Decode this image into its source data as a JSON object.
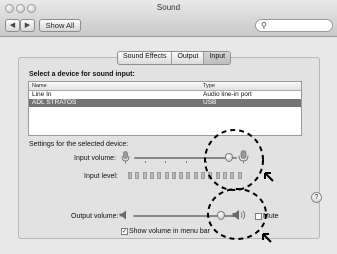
{
  "window": {
    "title": "Sound"
  },
  "toolbar": {
    "back": "◀",
    "forward": "▶",
    "show_all": "Show All",
    "search_placeholder": ""
  },
  "tabs": [
    {
      "label": "Sound Effects",
      "selected": false
    },
    {
      "label": "Output",
      "selected": false
    },
    {
      "label": "Input",
      "selected": true
    }
  ],
  "panel": {
    "heading": "Select a device for sound input:",
    "columns": [
      "Name",
      "Type"
    ],
    "devices": [
      {
        "name": "Line In",
        "type": "Audio line-in port",
        "selected": false
      },
      {
        "name": "ADL STRATOS",
        "type": "USB",
        "selected": true
      }
    ],
    "settings_label": "Settings for the selected device:",
    "input_volume_label": "Input volume:",
    "input_level_label": "Input level:",
    "input_volume_value": 0.92
  },
  "output": {
    "label": "Output volume:",
    "volume_value": 0.88,
    "mute_label": "Mute",
    "mute_checked": false,
    "show_in_menu_label": "Show volume in menu bar",
    "show_in_menu_checked": true
  },
  "help": "?"
}
